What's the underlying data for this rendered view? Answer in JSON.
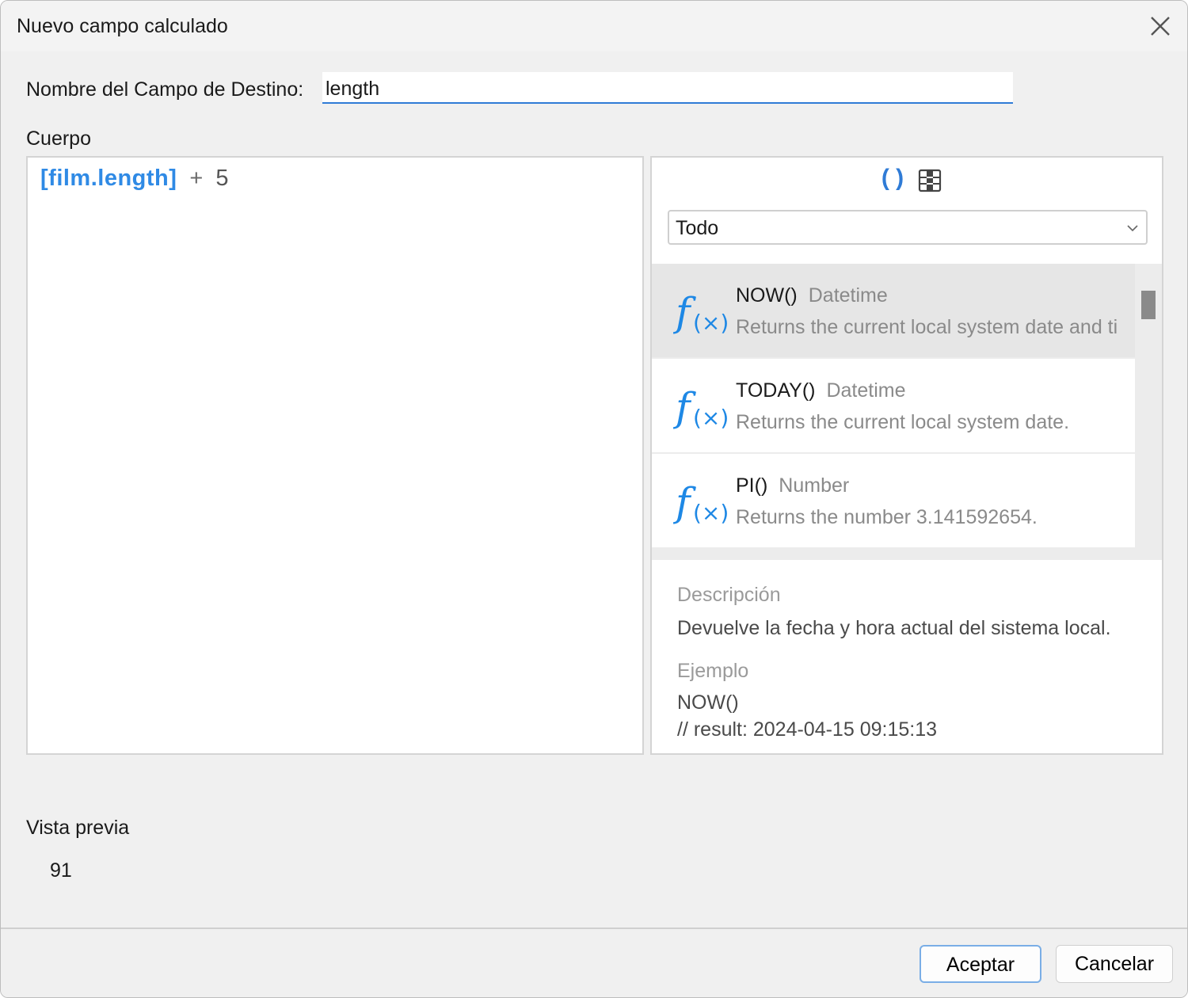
{
  "window": {
    "title": "Nuevo campo calculado"
  },
  "target": {
    "label": "Nombre del Campo de Destino:",
    "value": "length"
  },
  "body": {
    "label": "Cuerpo",
    "tokens": {
      "field": "[film.length]",
      "operator": "+",
      "number": "5"
    }
  },
  "functions_panel": {
    "category": {
      "selected": "Todo"
    },
    "items": [
      {
        "name": "NOW()",
        "type": "Datetime",
        "description": "Returns the current local system date and ti",
        "selected": true
      },
      {
        "name": "TODAY()",
        "type": "Datetime",
        "description": "Returns the current local system date."
      },
      {
        "name": "PI()",
        "type": "Number",
        "description": "Returns the number 3.141592654."
      }
    ],
    "details": {
      "description_label": "Descripción",
      "description": "Devuelve la fecha y hora actual del sistema local.",
      "example_label": "Ejemplo",
      "example_code": "NOW()",
      "example_result": "// result: 2024-04-15 09:15:13"
    }
  },
  "preview": {
    "label": "Vista previa",
    "value": "91"
  },
  "footer": {
    "ok_label": "Aceptar",
    "cancel_label": "Cancelar"
  },
  "icons": {
    "close": "close-icon",
    "parentheses": "parentheses-icon",
    "fields": "table-columns-icon",
    "function": "function-fx-icon",
    "dropdown": "chevron-down-icon"
  },
  "colors": {
    "accent": "#2f7bd6",
    "field_token": "#2f8ae5",
    "fx_icon": "#1e88e5"
  }
}
